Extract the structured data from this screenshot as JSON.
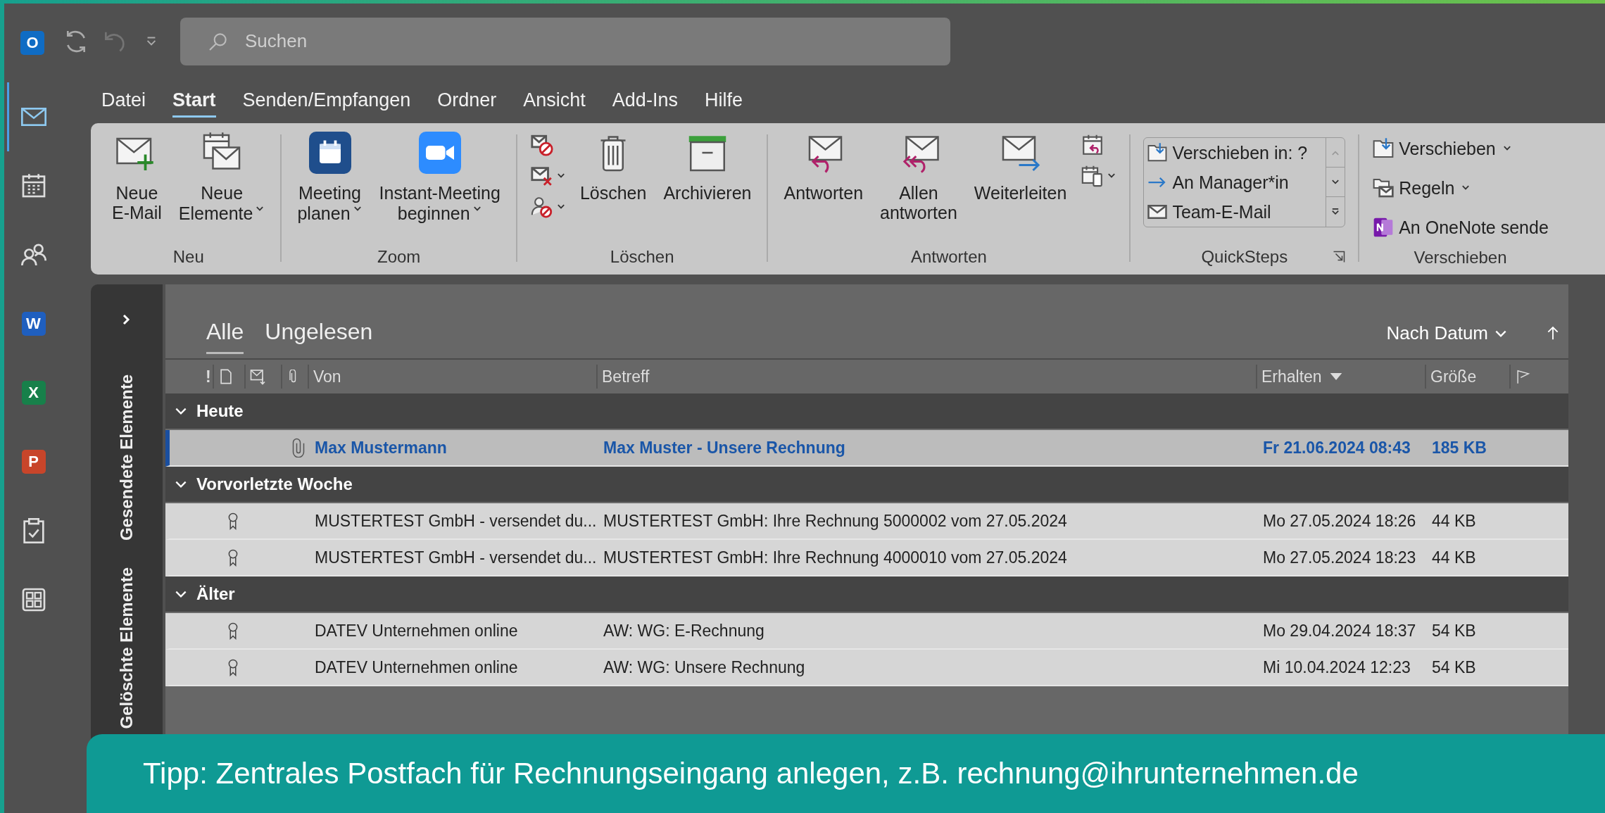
{
  "title_bar": {
    "logo_letter": "O",
    "search": {
      "placeholder": "Suchen"
    },
    "undo_disabled": true
  },
  "app_rail": [
    {
      "kind": "mail",
      "selected": true
    },
    {
      "kind": "calendar",
      "selected": false
    },
    {
      "kind": "people",
      "selected": false
    },
    {
      "kind": "app",
      "letter": "W",
      "color": "#1f5fbf",
      "selected": false
    },
    {
      "kind": "app",
      "letter": "X",
      "color": "#17804a",
      "selected": false
    },
    {
      "kind": "app",
      "letter": "P",
      "color": "#c8452a",
      "selected": false
    },
    {
      "kind": "tasks",
      "selected": false
    },
    {
      "kind": "apps",
      "selected": false
    }
  ],
  "menu_tabs": [
    {
      "label": "Datei",
      "selected": false
    },
    {
      "label": "Start",
      "selected": true
    },
    {
      "label": "Senden/Empfangen",
      "selected": false
    },
    {
      "label": "Ordner",
      "selected": false
    },
    {
      "label": "Ansicht",
      "selected": false
    },
    {
      "label": "Add-Ins",
      "selected": false
    },
    {
      "label": "Hilfe",
      "selected": false
    }
  ],
  "ribbon": {
    "groups": [
      {
        "label": "Neu",
        "items": [
          {
            "kind": "large",
            "lines": [
              "Neue",
              "E-Mail"
            ],
            "dropdown": false
          },
          {
            "kind": "large",
            "lines": [
              "Neue",
              "Elemente"
            ],
            "dropdown": true
          }
        ]
      },
      {
        "label": "Zoom",
        "items": [
          {
            "kind": "large",
            "lines": [
              "Meeting",
              "planen"
            ],
            "dropdown": true
          },
          {
            "kind": "large",
            "lines": [
              "Instant-Meeting",
              "beginnen"
            ],
            "dropdown": true
          }
        ]
      },
      {
        "label": "Löschen",
        "items": [
          {
            "kind": "stack",
            "buttons": [
              {
                "dropdown": false
              },
              {
                "dropdown": true
              },
              {
                "dropdown": true
              }
            ]
          },
          {
            "kind": "large",
            "lines": [
              "Löschen"
            ],
            "dropdown": false
          },
          {
            "kind": "large",
            "lines": [
              "Archivieren"
            ],
            "dropdown": false
          }
        ]
      },
      {
        "label": "Antworten",
        "items": [
          {
            "kind": "large",
            "lines": [
              "Antworten"
            ],
            "dropdown": false
          },
          {
            "kind": "large",
            "lines": [
              "Allen",
              "antworten"
            ],
            "dropdown": false
          },
          {
            "kind": "large",
            "lines": [
              "Weiterleiten"
            ],
            "dropdown": false
          },
          {
            "kind": "stack",
            "buttons": [
              {
                "dropdown": false
              },
              {
                "dropdown": true
              }
            ]
          }
        ]
      },
      {
        "label": "QuickSteps",
        "launcher": true,
        "items": [
          {
            "kind": "gallery",
            "entries": [
              "Verschieben in: ?",
              "An Manager*in",
              "Team-E-Mail"
            ]
          }
        ]
      },
      {
        "label": "Verschieben",
        "items": [
          {
            "kind": "list",
            "buttons": [
              {
                "label": "Verschieben",
                "dropdown": true
              },
              {
                "label": "Regeln",
                "dropdown": true
              },
              {
                "label": "An OneNote sende",
                "dropdown": false
              }
            ]
          }
        ]
      }
    ]
  },
  "folder_pane": {
    "expanded": false,
    "folders": [
      "Gesendete Elemente",
      "Gelöschte Elemente"
    ]
  },
  "mail_list": {
    "filters": [
      {
        "label": "Alle",
        "selected": true
      },
      {
        "label": "Ungelesen",
        "selected": false
      }
    ],
    "sort": {
      "label": "Nach Datum"
    },
    "columns": {
      "importance": "!",
      "from": "Von",
      "subject": "Betreff",
      "received": "Erhalten",
      "size": "Größe"
    },
    "groups": [
      {
        "label": "Heute",
        "expanded": true,
        "items": [
          {
            "from": "Max Mustermann",
            "subject": "Max Muster - Unsere Rechnung",
            "received": "Fr 21.06.2024 08:43",
            "size": "185 KB",
            "attachment": true,
            "signed": false,
            "unread": true,
            "selected": true
          }
        ]
      },
      {
        "label": "Vorvorletzte Woche",
        "expanded": true,
        "items": [
          {
            "from": "MUSTERTEST GmbH - versendet du...",
            "subject": "MUSTERTEST GmbH: Ihre Rechnung 5000002 vom 27.05.2024",
            "received": "Mo 27.05.2024 18:26",
            "size": "44 KB",
            "attachment": false,
            "signed": true,
            "unread": false,
            "selected": false
          },
          {
            "from": "MUSTERTEST GmbH - versendet du...",
            "subject": "MUSTERTEST GmbH: Ihre Rechnung 4000010 vom 27.05.2024",
            "received": "Mo 27.05.2024 18:23",
            "size": "44 KB",
            "attachment": false,
            "signed": true,
            "unread": false,
            "selected": false
          }
        ]
      },
      {
        "label": "Älter",
        "expanded": true,
        "items": [
          {
            "from": "DATEV Unternehmen online",
            "subject": "AW: WG: E-Rechnung",
            "received": "Mo 29.04.2024 18:37",
            "size": "54 KB",
            "attachment": false,
            "signed": true,
            "unread": false,
            "selected": false
          },
          {
            "from": "DATEV Unternehmen online",
            "subject": "AW: WG: Unsere Rechnung",
            "received": "Mi 10.04.2024 12:23",
            "size": "54 KB",
            "attachment": false,
            "signed": true,
            "unread": false,
            "selected": false
          }
        ]
      }
    ]
  },
  "tip_banner": "Tipp: Zentrales Postfach für Rechnungseingang anlegen, z.B. rechnung@ihrunternehmen.de"
}
